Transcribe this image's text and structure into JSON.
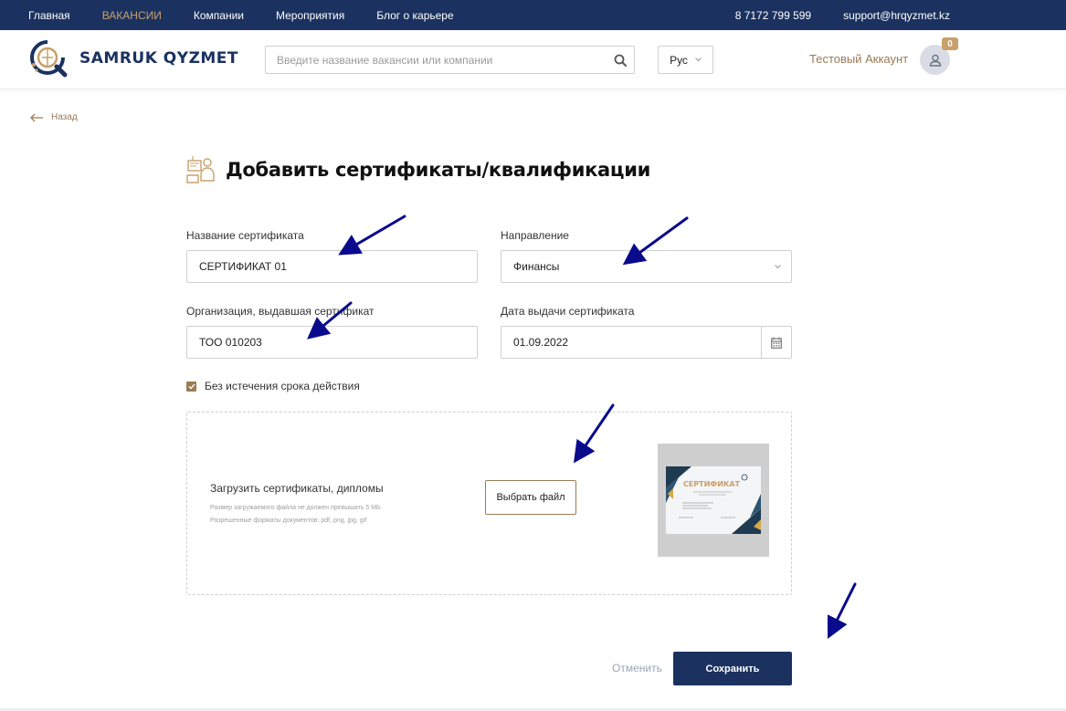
{
  "topbar": {
    "nav": [
      "Главная",
      "ВАКАНСИИ",
      "Компании",
      "Мероприятия",
      "Блог о карьере"
    ],
    "phone": "8 7172 799 599",
    "email": "support@hrqyzmet.kz"
  },
  "header": {
    "logo_text": "SAMRUK QYZMET",
    "search_placeholder": "Введите название вакансии или компании",
    "language": "Рус",
    "account_name": "Тестовый Аккаунт",
    "notification_count": "0"
  },
  "back_label": "Назад",
  "page_title": "Добавить сертификаты/квалификации",
  "form": {
    "cert_name_label": "Название сертификата",
    "cert_name_value": "СЕРТИФИКАТ 01",
    "direction_label": "Направление",
    "direction_value": "Финансы",
    "org_label": "Организация, выдавшая сертификат",
    "org_value": "ТОО 010203",
    "date_label": "Дата выдачи сертификата",
    "date_value": "01.09.2022",
    "no_expiry_label": "Без истечения срока действия",
    "no_expiry_checked": true
  },
  "upload": {
    "title": "Загрузить сертификаты, дипломы",
    "note_size": "Размер загружаемого файла не должен превышать 5 Mb.",
    "note_formats": "Разрешенные форматы документов: pdf, png, jpg, gif",
    "choose_button": "Выбрать файл",
    "preview_title": "СЕРТИФИКАТ"
  },
  "actions": {
    "cancel": "Отменить",
    "save": "Сохранить"
  },
  "colors": {
    "navy": "#1b3260",
    "gold": "#c9a06a",
    "brown": "#9b7b55",
    "annotation_arrow": "#0a0a8c"
  }
}
